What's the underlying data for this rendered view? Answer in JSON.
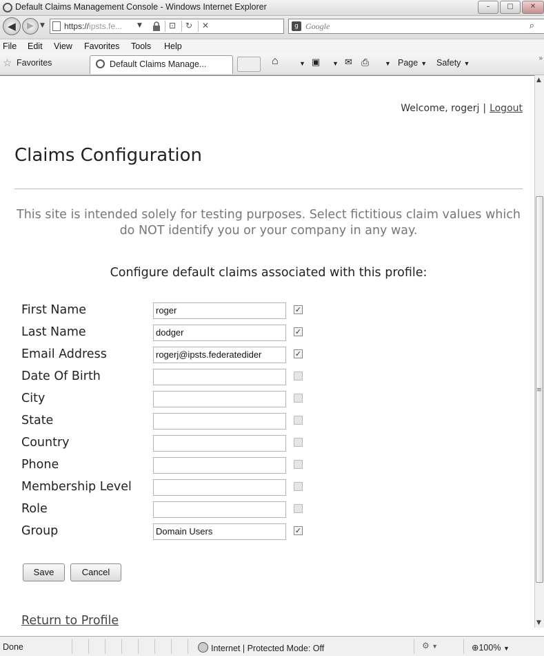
{
  "window": {
    "title": "Default Claims Management Console - Windows Internet Explorer",
    "controls": {
      "minimize": "–",
      "maximize": "□",
      "close": "✕"
    }
  },
  "address_bar": {
    "url_prefix": "https://",
    "url_host": "ipsts.fe...",
    "search_placeholder": "Google"
  },
  "menu": [
    "File",
    "Edit",
    "View",
    "Favorites",
    "Tools",
    "Help"
  ],
  "favorites_bar": {
    "favorites_label": "Favorites",
    "tab_title": "Default Claims Manage...",
    "commands": {
      "page": "Page",
      "safety": "Safety"
    }
  },
  "header": {
    "welcome_text": "Welcome, rogerj",
    "separator": "|",
    "logout": "Logout"
  },
  "page": {
    "title": "Claims Configuration",
    "notice": "This site is intended solely for testing purposes. Select fictitious claim values which do NOT identify you or your company in any way.",
    "configure_heading": "Configure default claims associated with this profile:"
  },
  "claims": [
    {
      "label": "First Name",
      "value": "roger",
      "checked": true
    },
    {
      "label": "Last Name",
      "value": "dodger",
      "checked": true
    },
    {
      "label": "Email Address",
      "value": "rogerj@ipsts.federatedider",
      "checked": true
    },
    {
      "label": "Date Of Birth",
      "value": "",
      "checked": false
    },
    {
      "label": "City",
      "value": "",
      "checked": false
    },
    {
      "label": "State",
      "value": "",
      "checked": false
    },
    {
      "label": "Country",
      "value": "",
      "checked": false
    },
    {
      "label": "Phone",
      "value": "",
      "checked": false
    },
    {
      "label": "Membership Level",
      "value": "",
      "checked": false
    },
    {
      "label": "Role",
      "value": "",
      "checked": false
    },
    {
      "label": "Group",
      "value": "Domain Users",
      "checked": true
    }
  ],
  "buttons": {
    "save": "Save",
    "cancel": "Cancel"
  },
  "return_link": "Return to Profile",
  "status_bar": {
    "status": "Done",
    "zone": "Internet | Protected Mode: Off",
    "zoom": "100%"
  }
}
